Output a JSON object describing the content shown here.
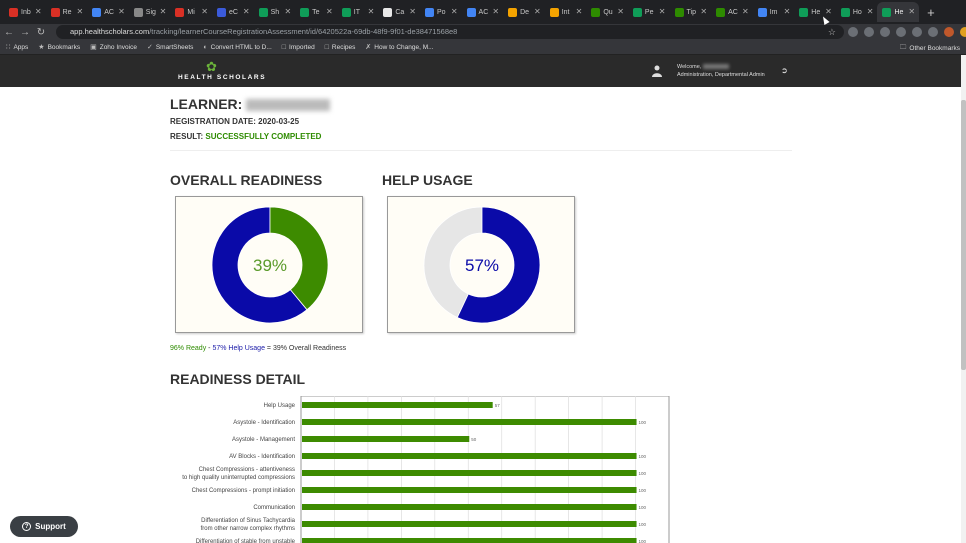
{
  "browser": {
    "tabs": [
      {
        "label": "Inb",
        "color": "#d93025"
      },
      {
        "label": "Re",
        "color": "#d93025"
      },
      {
        "label": "AC",
        "color": "#4285f4"
      },
      {
        "label": "Sig",
        "color": "#888888"
      },
      {
        "label": "Mi",
        "color": "#d93025"
      },
      {
        "label": "eC",
        "color": "#3b5bdb"
      },
      {
        "label": "Sh",
        "color": "#0f9d58"
      },
      {
        "label": "Te",
        "color": "#0f9d58"
      },
      {
        "label": "IT",
        "color": "#0f9d58"
      },
      {
        "label": "Ca",
        "color": "#e8e8e8"
      },
      {
        "label": "Po",
        "color": "#4285f4"
      },
      {
        "label": "AC",
        "color": "#4285f4"
      },
      {
        "label": "De",
        "color": "#f4a300"
      },
      {
        "label": "Int",
        "color": "#f4a300"
      },
      {
        "label": "Qu",
        "color": "#2e8b00"
      },
      {
        "label": "Pe",
        "color": "#0f9d58"
      },
      {
        "label": "Tip",
        "color": "#2e8b00"
      },
      {
        "label": "AC",
        "color": "#2e8b00"
      },
      {
        "label": "Im",
        "color": "#4285f4"
      },
      {
        "label": "He",
        "color": "#0f9d58"
      },
      {
        "label": "Ho",
        "color": "#0f9d58"
      },
      {
        "label": "He",
        "color": "#0f9d58",
        "active": true
      }
    ],
    "new_tab": "+",
    "url_host": "app.healthscholars.com",
    "url_path": "/tracking/learnerCourseRegistrationAssessment/id/6420522a-69db-48f9-9f01-de38471568e8",
    "bookmarks": [
      {
        "label": "Apps",
        "icon": "grid-icon"
      },
      {
        "label": "Bookmarks",
        "icon": "star-icon"
      },
      {
        "label": "Zoho Invoice",
        "icon": "zoho-icon"
      },
      {
        "label": "SmartSheets",
        "icon": "check-icon"
      },
      {
        "label": "Convert HTML to D...",
        "icon": "convert-icon"
      },
      {
        "label": "Imported",
        "icon": "folder-icon"
      },
      {
        "label": "Recipes",
        "icon": "folder-icon"
      },
      {
        "label": "How to Change, M...",
        "icon": "x-icon"
      }
    ],
    "other_bookmarks": "Other Bookmarks"
  },
  "app": {
    "logo_text": "HEALTH SCHOLARS",
    "welcome": "Welcome,",
    "role": "Administration, Departmental Admin"
  },
  "learner": {
    "label": "LEARNER:",
    "registration_label": "REGISTRATION DATE:",
    "registration_date": "2020-03-25",
    "result_label": "RESULT:",
    "result_value": "SUCCESSFULLY COMPLETED"
  },
  "overall": {
    "title": "OVERALL READINESS",
    "percent_text": "39%",
    "value": 39,
    "color": "#3d8b00",
    "rest_color": "#0a0aa8"
  },
  "help": {
    "title": "HELP USAGE",
    "percent_text": "57%",
    "value": 57,
    "color": "#0a0aa8",
    "rest_color": "#e6e6e6"
  },
  "summary": {
    "ready": "96% Ready",
    "sep1": " - ",
    "help": "57% Help Usage",
    "eq": " = ",
    "overall": "39% Overall Readiness"
  },
  "detail": {
    "title": "READINESS DETAIL"
  },
  "chart_data": {
    "type": "bar",
    "orientation": "horizontal",
    "categories": [
      "Help Usage",
      "Asystole - Identification",
      "Asystole - Management",
      "AV Blocks - Identification",
      "Chest Compressions - attentiveness to high quality uninterrupted compressions",
      "Chest Compressions - prompt initiation",
      "Communication",
      "Differentiation of Sinus Tachycardia from other narrow complex rhythms",
      "Differentiation of stable from unstable"
    ],
    "category_lines": [
      [
        "Help Usage"
      ],
      [
        "Asystole - Identification"
      ],
      [
        "Asystole - Management"
      ],
      [
        "AV Blocks - Identification"
      ],
      [
        "Chest Compressions - attentiveness",
        "to high quality uninterrupted compressions"
      ],
      [
        "Chest Compressions - prompt initiation"
      ],
      [
        "Communication"
      ],
      [
        "Differentiation of Sinus Tachycardia",
        "from other narrow complex rhythms"
      ],
      [
        "Differentiation of stable from unstable"
      ]
    ],
    "values": [
      57,
      100,
      50,
      100,
      100,
      100,
      100,
      100,
      100
    ],
    "xlim": [
      0,
      110
    ],
    "bar_color": "#3d8b00"
  },
  "support": {
    "label": "Support"
  }
}
